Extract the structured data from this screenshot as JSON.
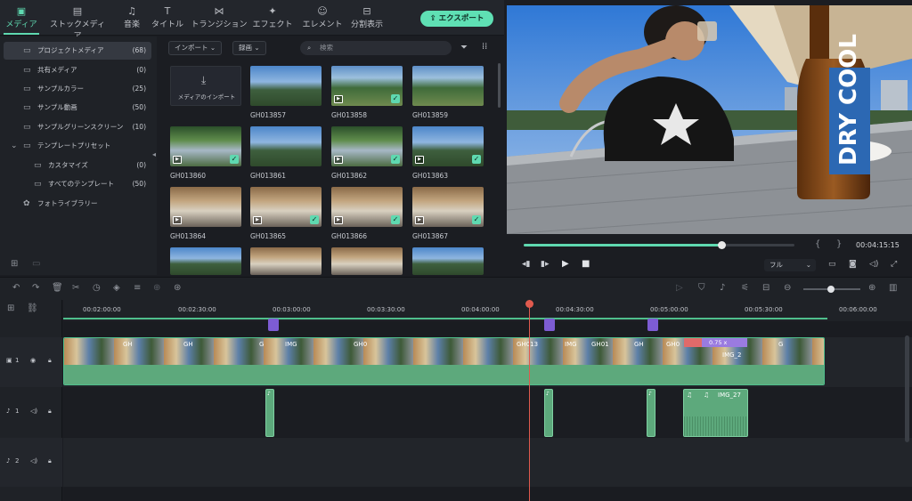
{
  "nav": {
    "tabs": [
      {
        "label": "メディア",
        "icon": "media-icon"
      },
      {
        "label": "ストックメディア",
        "icon": "stock-icon"
      },
      {
        "label": "音楽",
        "icon": "music-icon"
      },
      {
        "label": "タイトル",
        "icon": "title-icon"
      },
      {
        "label": "トランジション",
        "icon": "transition-icon"
      },
      {
        "label": "エフェクト",
        "icon": "effect-icon"
      },
      {
        "label": "エレメント",
        "icon": "element-icon"
      },
      {
        "label": "分割表示",
        "icon": "split-icon"
      }
    ],
    "export_label": "エクスポート"
  },
  "tree": {
    "items": [
      {
        "label": "プロジェクトメディア",
        "count": "(68)"
      },
      {
        "label": "共有メディア",
        "count": "(0)"
      },
      {
        "label": "サンプルカラー",
        "count": "(25)"
      },
      {
        "label": "サンプル動画",
        "count": "(50)"
      },
      {
        "label": "サンプルグリーンスクリーン",
        "count": "(10)"
      },
      {
        "label": "テンプレートプリセット",
        "count": ""
      },
      {
        "label": "カスタマイズ",
        "count": "(0)"
      },
      {
        "label": "すべてのテンプレート",
        "count": "(50)"
      },
      {
        "label": "フォトライブラリー",
        "count": ""
      }
    ]
  },
  "media": {
    "import_label": "インポート",
    "record_label": "録画",
    "search_placeholder": "検索",
    "import_tile_label": "メディアのインポート",
    "clips": [
      "GH013857",
      "GH013858",
      "GH013859",
      "GH013860",
      "GH013861",
      "GH013862",
      "GH013863",
      "GH013864",
      "GH013865",
      "GH013866",
      "GH013867"
    ]
  },
  "preview": {
    "timecode": "00:04:15:15",
    "quality": "フル",
    "progress": 0.73
  },
  "timeline": {
    "ruler": [
      "00:02:00:00",
      "00:02:30:00",
      "00:03:00:00",
      "00:03:30:00",
      "00:04:00:00",
      "00:04:30:00",
      "00:05:00:00",
      "00:05:30:00",
      "00:06:00:00"
    ],
    "tracks": [
      {
        "name": "1",
        "kind": "video"
      },
      {
        "name": "1",
        "kind": "audio"
      },
      {
        "name": "2",
        "kind": "audio"
      }
    ],
    "clip_labels": [
      "GH",
      "GH",
      "G",
      "IMG",
      "GH0",
      "GH013",
      "IMG",
      "GH01",
      "GH",
      "GH0",
      "IMG_2",
      "G"
    ],
    "speed_badge": "0.75 x",
    "audio_clip_label": "IMG_27"
  }
}
